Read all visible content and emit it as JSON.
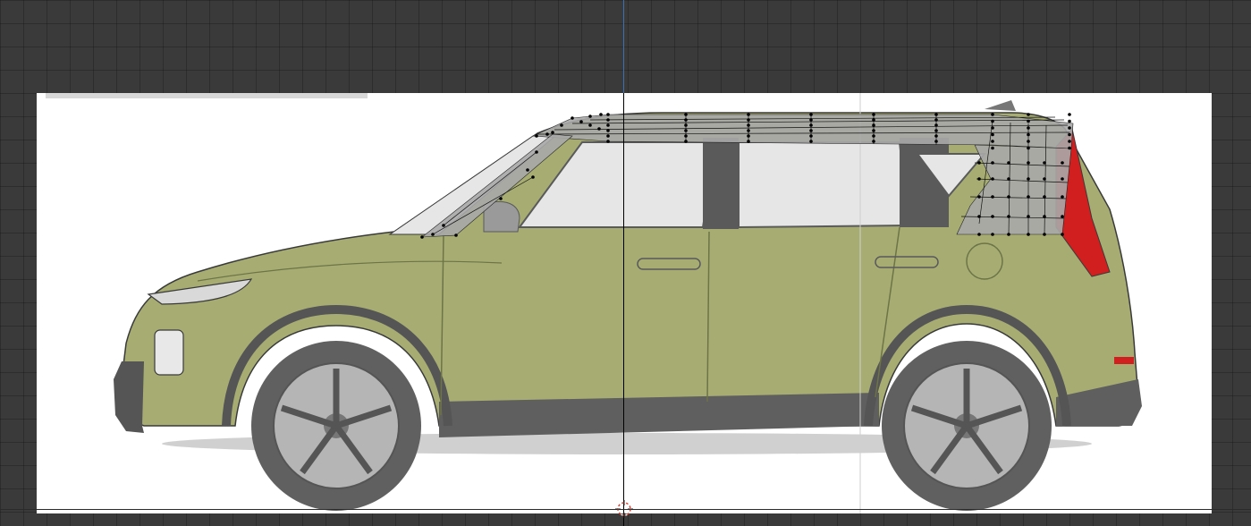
{
  "viewport": {
    "mode": "side-orthographic",
    "grid": true
  },
  "reference_image": {
    "subject": "car-side-view",
    "colors": {
      "body": "#a7ad72",
      "body_shadow": "#8e955d",
      "trim": "#5c5c5c",
      "glass": "#e6e6e6",
      "taillight": "#d11f1f",
      "wheel": "#8a8a8a",
      "outline": "#3a3a3a"
    }
  },
  "mesh": {
    "colors": {
      "face": "#a9a9a9",
      "edge": "#000000",
      "vertex": "#000000"
    }
  },
  "axes": {
    "colors": {
      "vertical": "#000000",
      "vertical_top": "#3f6fb0",
      "cursor_ring": "#d63b2b"
    }
  }
}
